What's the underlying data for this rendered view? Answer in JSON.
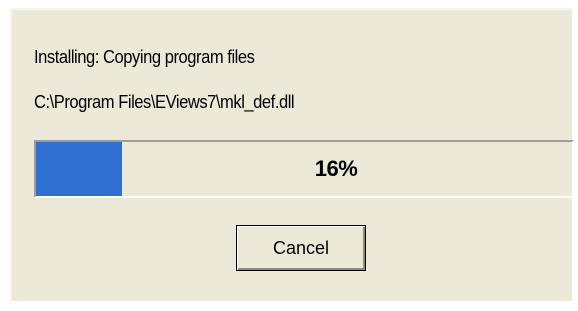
{
  "installer": {
    "status_line": "Installing: Copying program files",
    "file_path": "C:\\Program Files\\EViews7\\mkl_def.dll",
    "progress": {
      "percent": 16,
      "label": "16%"
    },
    "cancel_label": "Cancel"
  },
  "colors": {
    "dialog_background": "#ece9d8",
    "progress_fill": "#2f6fd0"
  }
}
